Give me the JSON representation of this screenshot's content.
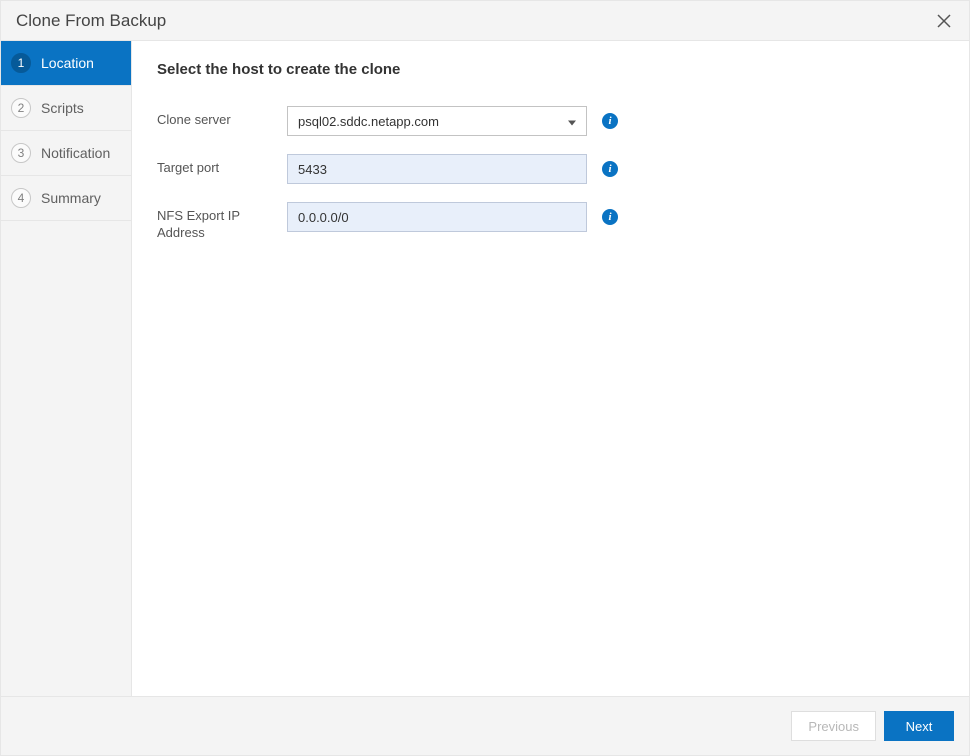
{
  "dialog": {
    "title": "Clone From Backup"
  },
  "steps": [
    {
      "num": "1",
      "label": "Location"
    },
    {
      "num": "2",
      "label": "Scripts"
    },
    {
      "num": "3",
      "label": "Notification"
    },
    {
      "num": "4",
      "label": "Summary"
    }
  ],
  "form": {
    "heading": "Select the host to create the clone",
    "cloneServer": {
      "label": "Clone server",
      "value": "psql02.sddc.netapp.com"
    },
    "targetPort": {
      "label": "Target port",
      "value": "5433"
    },
    "nfsExport": {
      "label": "NFS Export IP Address",
      "value": "0.0.0.0/0"
    }
  },
  "footer": {
    "previous": "Previous",
    "next": "Next"
  },
  "info_glyph": "i"
}
